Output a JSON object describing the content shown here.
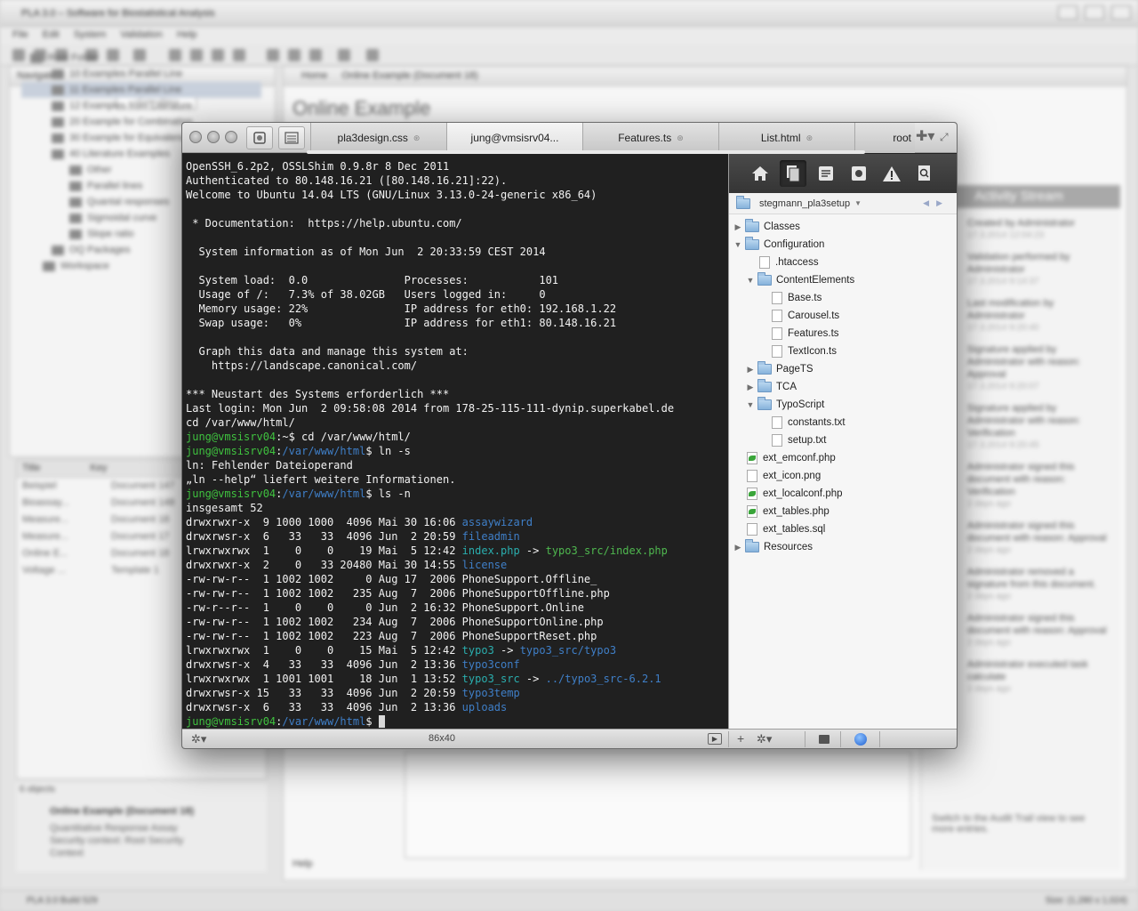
{
  "background_app": {
    "title": "PLA 3.0 – Software for Biostatistical Analysis",
    "menu": [
      "File",
      "Edit",
      "System",
      "Validation",
      "Help"
    ],
    "navigator_label": "Navigator",
    "filter_placeholder": "<Enter filter>",
    "tree": [
      "Root Folder",
      "10 Examples Parallel Line",
      "11 Examples Parallel Line",
      "12 Examples from Literature",
      "20 Example for Combination",
      "30 Example for Equivalence",
      "40 Literature Examples",
      "Other",
      "Parallel lines",
      "Quantal responses",
      "Sigmoidal curve",
      "Slope ratio",
      "OQ Packages",
      "Workspace"
    ],
    "table_headers": [
      "Title",
      "Key"
    ],
    "table_rows": [
      [
        "Beispiel",
        "Document 147"
      ],
      [
        "Bioassay...",
        "Document 148"
      ],
      [
        "Measure...",
        "Document 18"
      ],
      [
        "Measure...",
        "Document 17"
      ],
      [
        "Online E...",
        "Document 18"
      ],
      [
        "Voltage ...",
        "Template 1"
      ]
    ],
    "object_count": "6 objects",
    "props_title": "Online Example (Document 18)",
    "props_desc": "Quantitative Response Assay Security context: Root Security Context",
    "main_tabs": [
      "Home",
      "Online Example (Document 18)"
    ],
    "page_title": "Online Example",
    "help_label": "Help",
    "activity_header": "Activity Stream",
    "activity": [
      {
        "text": "Created by Administrator",
        "time": "17.3.2014 12:04:23"
      },
      {
        "text": "Validation performed by Administrator",
        "time": "17.3.2014 9:14:37"
      },
      {
        "text": "Last modification by Administrator",
        "time": "17.3.2014 9:20:40"
      },
      {
        "text": "Signature applied by Administrator with reason: Approval",
        "time": "17.3.2014 9:20:07"
      },
      {
        "text": "Signature applied by Administrator with reason: Verification",
        "time": "17.3.2014 9:20:45"
      },
      {
        "text": "Administrator signed this document with reason: Verification",
        "time": "2 days ago"
      },
      {
        "text": "Administrator signed this document with reason: Approval",
        "time": "2 days ago"
      },
      {
        "text": "Administrator removed a signature from this document.",
        "time": "2 days ago"
      },
      {
        "text": "Administrator signed this document with reason: Approval",
        "time": "2 days ago"
      },
      {
        "text": "Administrator executed task calculate",
        "time": "2 days ago"
      }
    ],
    "activity_footer": "Switch to the Audit Trail view to see more entries.",
    "status_left": "PLA 3.0 Build 529",
    "status_right": "Size: (1,280 x 1,024)"
  },
  "terminal_window": {
    "tabs": [
      {
        "label": "pla3design.css",
        "modified": true,
        "active": false
      },
      {
        "label": "jung@vmsisrv04...",
        "modified": false,
        "active": true
      },
      {
        "label": "Features.ts",
        "modified": true,
        "active": false
      },
      {
        "label": "List.html",
        "modified": true,
        "active": false
      },
      {
        "label": "root",
        "modified": false,
        "active": false
      }
    ],
    "terminal_lines": [
      [
        {
          "t": "OpenSSH_6.2p2, OSSLShim 0.9.8r 8 Dec 2011"
        }
      ],
      [
        {
          "t": "Authenticated to 80.148.16.21 ([80.148.16.21]:22)."
        }
      ],
      [
        {
          "t": "Welcome to Ubuntu 14.04 LTS (GNU/Linux 3.13.0-24-generic x86_64)"
        }
      ],
      [
        {
          "t": ""
        }
      ],
      [
        {
          "t": " * Documentation:  https://help.ubuntu.com/"
        }
      ],
      [
        {
          "t": ""
        }
      ],
      [
        {
          "t": "  System information as of Mon Jun  2 20:33:59 CEST 2014"
        }
      ],
      [
        {
          "t": ""
        }
      ],
      [
        {
          "t": "  System load:  0.0               Processes:           101"
        }
      ],
      [
        {
          "t": "  Usage of /:   7.3% of 38.02GB   Users logged in:     0"
        }
      ],
      [
        {
          "t": "  Memory usage: 22%               IP address for eth0: 192.168.1.22"
        }
      ],
      [
        {
          "t": "  Swap usage:   0%                IP address for eth1: 80.148.16.21"
        }
      ],
      [
        {
          "t": ""
        }
      ],
      [
        {
          "t": "  Graph this data and manage this system at:"
        }
      ],
      [
        {
          "t": "    https://landscape.canonical.com/"
        }
      ],
      [
        {
          "t": ""
        }
      ],
      [
        {
          "t": "*** Neustart des Systems erforderlich ***"
        }
      ],
      [
        {
          "t": "Last login: Mon Jun  2 09:58:08 2014 from 178-25-115-111-dynip.superkabel.de"
        }
      ],
      [
        {
          "t": "cd /var/www/html/"
        }
      ],
      [
        {
          "t": "jung@vmsisrv04",
          "c": "c-green"
        },
        {
          "t": ":~$ cd /var/www/html/"
        }
      ],
      [
        {
          "t": "jung@vmsisrv04",
          "c": "c-green"
        },
        {
          "t": ":"
        },
        {
          "t": "/var/www/html",
          "c": "c-path"
        },
        {
          "t": "$ ln -s"
        }
      ],
      [
        {
          "t": "ln: Fehlender Dateioperand"
        }
      ],
      [
        {
          "t": "„ln --help“ liefert weitere Informationen."
        }
      ],
      [
        {
          "t": "jung@vmsisrv04",
          "c": "c-green"
        },
        {
          "t": ":"
        },
        {
          "t": "/var/www/html",
          "c": "c-path"
        },
        {
          "t": "$ ls -n"
        }
      ],
      [
        {
          "t": "insgesamt 52"
        }
      ],
      [
        {
          "t": "drwxrwxr-x  9 1000 1000  4096 Mai 30 16:06 "
        },
        {
          "t": "assaywizard",
          "c": "c-dir"
        }
      ],
      [
        {
          "t": "drwxrwsr-x  6   33   33  4096 Jun  2 20:59 "
        },
        {
          "t": "fileadmin",
          "c": "c-dir"
        }
      ],
      [
        {
          "t": "lrwxrwxrwx  1    0    0    19 Mai  5 12:42 "
        },
        {
          "t": "index.php",
          "c": "c-link"
        },
        {
          "t": " -> "
        },
        {
          "t": "typo3_src/index.php",
          "c": "c-target"
        }
      ],
      [
        {
          "t": "drwxrwxr-x  2    0   33 20480 Mai 30 14:55 "
        },
        {
          "t": "license",
          "c": "c-dir"
        }
      ],
      [
        {
          "t": "-rw-rw-r--  1 1002 1002     0 Aug 17  2006 PhoneSupport.Offline_"
        }
      ],
      [
        {
          "t": "-rw-rw-r--  1 1002 1002   235 Aug  7  2006 PhoneSupportOffline.php"
        }
      ],
      [
        {
          "t": "-rw-r--r--  1    0    0     0 Jun  2 16:32 PhoneSupport.Online"
        }
      ],
      [
        {
          "t": "-rw-rw-r--  1 1002 1002   234 Aug  7  2006 PhoneSupportOnline.php"
        }
      ],
      [
        {
          "t": "-rw-rw-r--  1 1002 1002   223 Aug  7  2006 PhoneSupportReset.php"
        }
      ],
      [
        {
          "t": "lrwxrwxrwx  1    0    0    15 Mai  5 12:42 "
        },
        {
          "t": "typo3",
          "c": "c-link"
        },
        {
          "t": " -> "
        },
        {
          "t": "typo3_src/typo3",
          "c": "c-dir"
        }
      ],
      [
        {
          "t": "drwxrwsr-x  4   33   33  4096 Jun  2 13:36 "
        },
        {
          "t": "typo3conf",
          "c": "c-dir"
        }
      ],
      [
        {
          "t": "lrwxrwxrwx  1 1001 1001    18 Jun  1 13:52 "
        },
        {
          "t": "typo3_src",
          "c": "c-link"
        },
        {
          "t": " -> "
        },
        {
          "t": "../typo3_src-6.2.1",
          "c": "c-broken"
        }
      ],
      [
        {
          "t": "drwxrwsr-x 15   33   33  4096 Jun  2 20:59 "
        },
        {
          "t": "typo3temp",
          "c": "c-dir"
        }
      ],
      [
        {
          "t": "drwxrwsr-x  6   33   33  4096 Jun  2 13:36 "
        },
        {
          "t": "uploads",
          "c": "c-dir"
        }
      ],
      [
        {
          "t": "jung@vmsisrv04",
          "c": "c-green"
        },
        {
          "t": ":"
        },
        {
          "t": "/var/www/html",
          "c": "c-path"
        },
        {
          "t": "$ "
        },
        {
          "cursor": true
        }
      ]
    ],
    "sidebar": {
      "icons": [
        "home-icon",
        "documents-icon",
        "snippets-icon",
        "extensions-icon",
        "warning-icon",
        "search-file-icon"
      ],
      "path_label": "stegmann_pla3setup",
      "tree": [
        {
          "label": "Classes",
          "type": "folder",
          "depth": 0,
          "state": "collapsed"
        },
        {
          "label": "Configuration",
          "type": "folder",
          "depth": 0,
          "state": "expanded"
        },
        {
          "label": ".htaccess",
          "type": "file",
          "depth": 1
        },
        {
          "label": "ContentElements",
          "type": "folder",
          "depth": 1,
          "state": "expanded"
        },
        {
          "label": "Base.ts",
          "type": "file",
          "depth": 2
        },
        {
          "label": "Carousel.ts",
          "type": "file",
          "depth": 2
        },
        {
          "label": "Features.ts",
          "type": "file",
          "depth": 2
        },
        {
          "label": "TextIcon.ts",
          "type": "file",
          "depth": 2
        },
        {
          "label": "PageTS",
          "type": "folder",
          "depth": 1,
          "state": "collapsed"
        },
        {
          "label": "TCA",
          "type": "folder",
          "depth": 1,
          "state": "collapsed"
        },
        {
          "label": "TypoScript",
          "type": "folder",
          "depth": 1,
          "state": "expanded"
        },
        {
          "label": "constants.txt",
          "type": "file",
          "depth": 2
        },
        {
          "label": "setup.txt",
          "type": "file",
          "depth": 2
        },
        {
          "label": "ext_emconf.php",
          "type": "php",
          "depth": 0
        },
        {
          "label": "ext_icon.png",
          "type": "file",
          "depth": 0
        },
        {
          "label": "ext_localconf.php",
          "type": "php",
          "depth": 0
        },
        {
          "label": "ext_tables.php",
          "type": "php",
          "depth": 0
        },
        {
          "label": "ext_tables.sql",
          "type": "file",
          "depth": 0
        },
        {
          "label": "Resources",
          "type": "folder",
          "depth": 0,
          "state": "collapsed"
        }
      ]
    },
    "status": {
      "size_label": "86x40"
    }
  }
}
